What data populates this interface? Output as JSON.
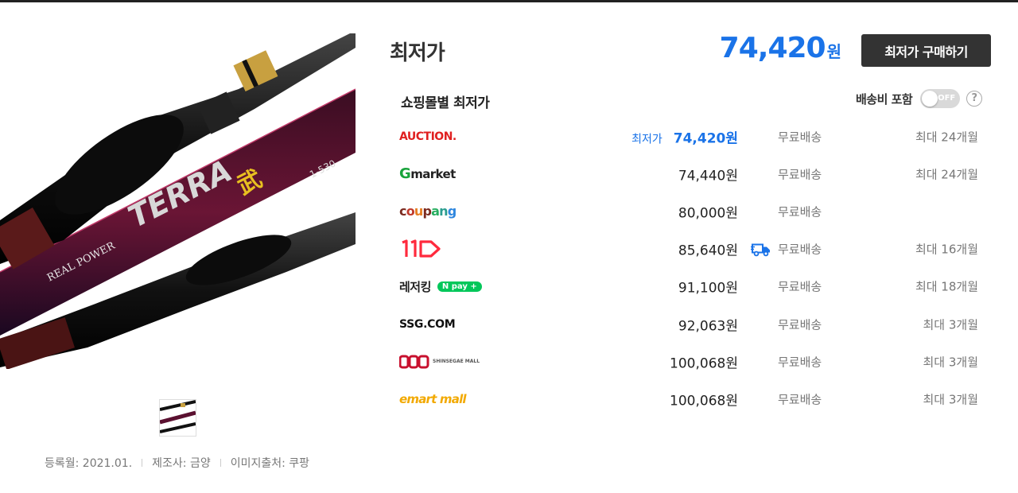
{
  "header": {
    "title": "최저가",
    "lowest_price": "74,420",
    "currency": "원",
    "buy_button": "최저가 구매하기"
  },
  "mall_section": {
    "subtitle": "쇼핑몰별 최저가",
    "shipping_toggle_label": "배송비 포함",
    "toggle_state": "OFF",
    "help_icon": "?"
  },
  "rows": [
    {
      "mall": "AUCTION.",
      "best_tag": "최저가",
      "price": "74,420원",
      "shipping": "무료배송",
      "installment": "최대 24개월"
    },
    {
      "mall": "market",
      "mall_prefix": "G",
      "price": "74,440원",
      "shipping": "무료배송",
      "installment": "최대 24개월"
    },
    {
      "mall": "coupang",
      "price": "80,000원",
      "shipping": "무료배송",
      "installment": ""
    },
    {
      "mall": "11",
      "price": "85,640원",
      "shipping": "무료배송",
      "installment": "최대 16개월",
      "truck_icon": true
    },
    {
      "mall": "레저킹",
      "mall_badge": "N pay +",
      "price": "91,100원",
      "shipping": "무료배송",
      "installment": "최대 18개월"
    },
    {
      "mall": "SSG.COM",
      "price": "92,063원",
      "shipping": "무료배송",
      "installment": "최대 3개월"
    },
    {
      "mall": "SHINSEGAE MALL",
      "price": "100,068원",
      "shipping": "무료배송",
      "installment": "최대 3개월"
    },
    {
      "mall": "emart mall",
      "price": "100,068원",
      "shipping": "무료배송",
      "installment": "최대 3개월"
    }
  ],
  "product_image": {
    "brand_text": "TERRA",
    "series_text": "REAL POWER",
    "model_text": "1-530"
  },
  "meta": {
    "registered": "등록월: 2021.01.",
    "maker": "제조사: 금양",
    "image_source": "이미지출처: 쿠팡"
  },
  "colors": {
    "accent_blue": "#1a73e8",
    "button_dark": "#333333",
    "auction_red": "#e02020",
    "gmarket_green": "#18a33b",
    "npay_green": "#03c75a",
    "emart_yellow": "#f2a900",
    "eleven_red": "#ff2a3d"
  }
}
